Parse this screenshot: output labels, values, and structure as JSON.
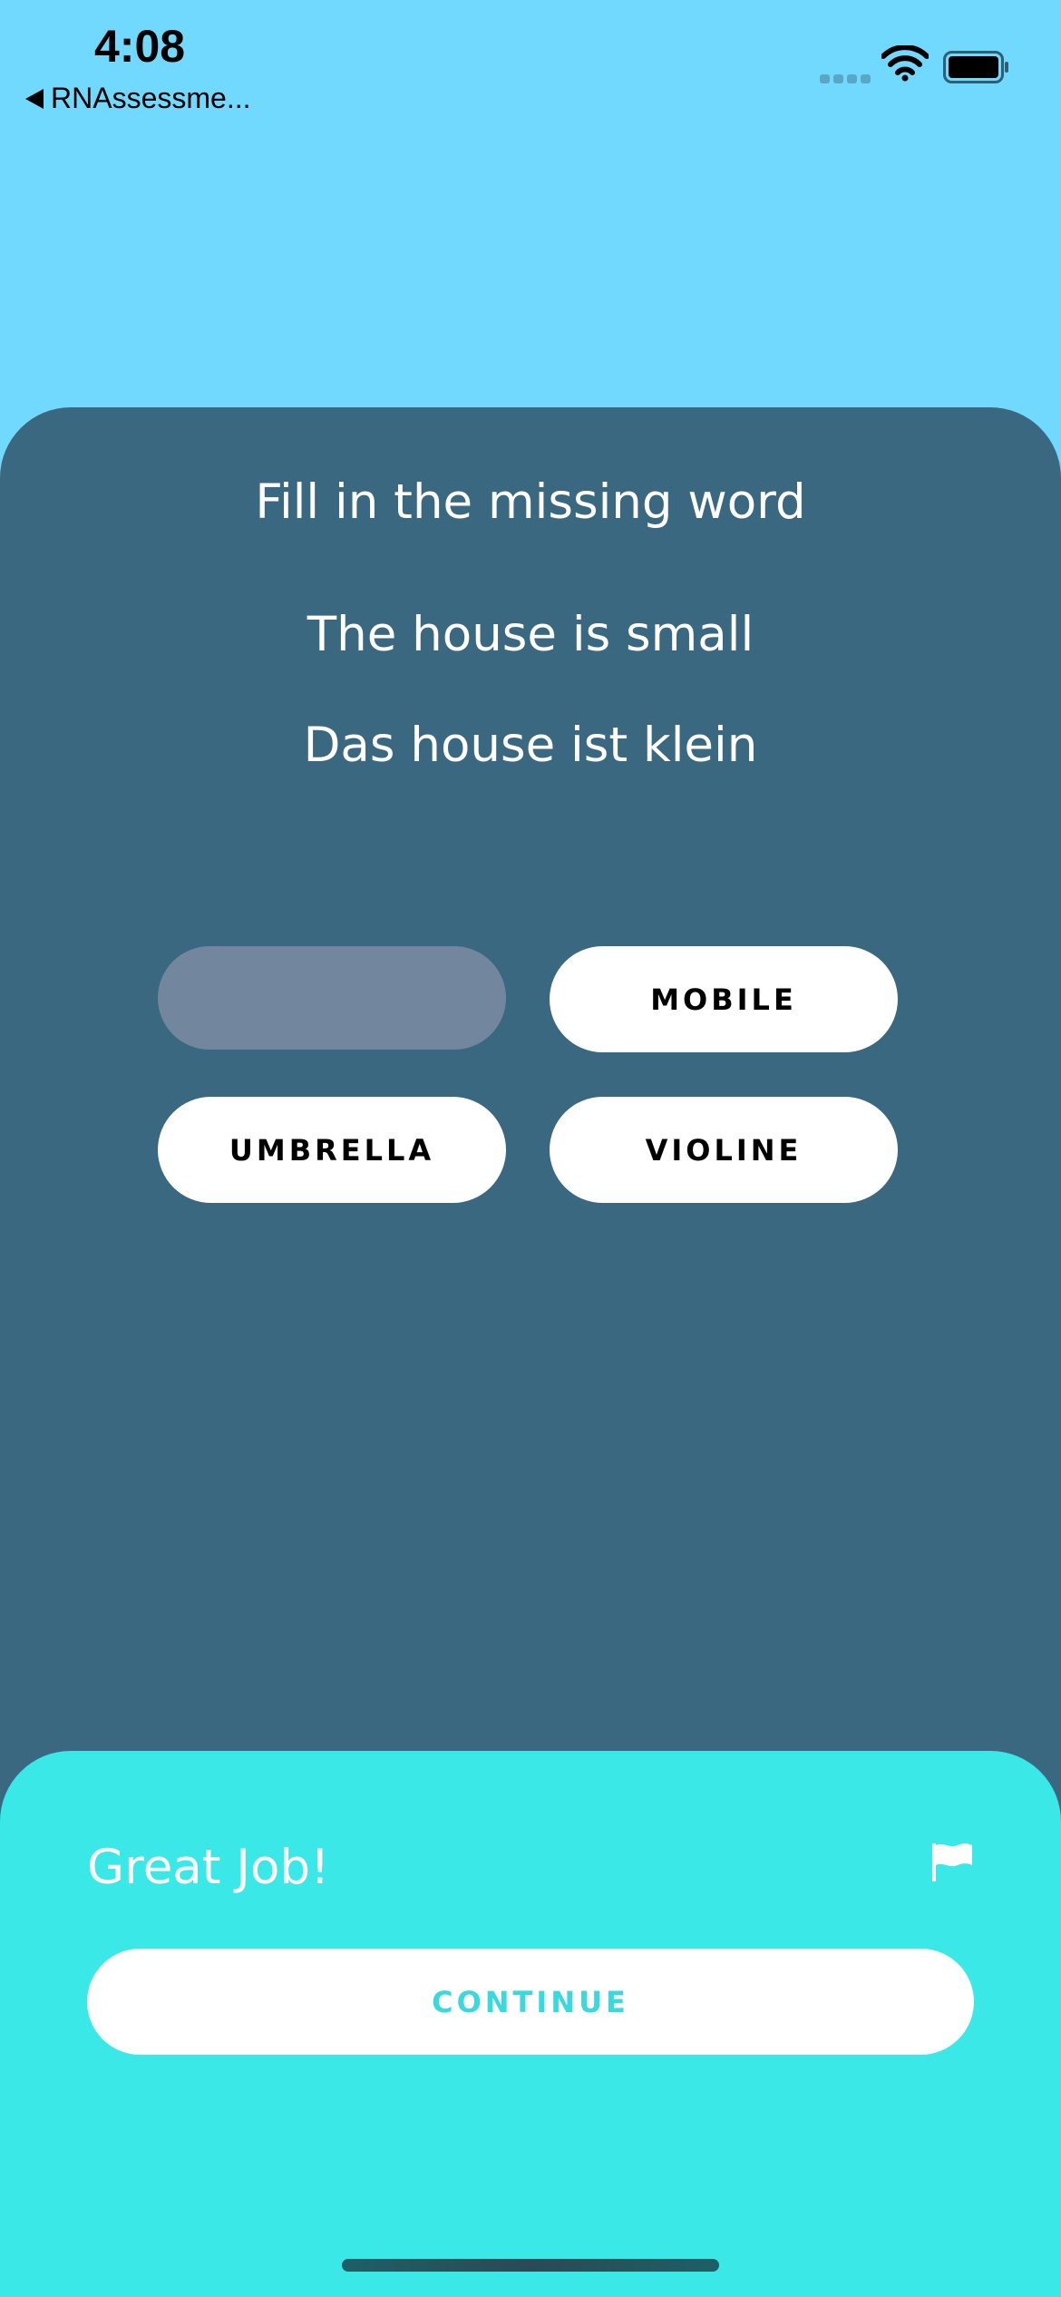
{
  "status_bar": {
    "time": "4:08",
    "back_label": "RNAssessme..."
  },
  "question": {
    "prompt": "Fill in the missing word",
    "sentence_english": "The house is small",
    "sentence_german": "Das house ist klein"
  },
  "options": {
    "empty_slot": "",
    "items": [
      "MOBILE",
      "UMBRELLA",
      "VIOLINE"
    ]
  },
  "feedback": {
    "title": "Great Job!",
    "continue_label": "CONTINUE"
  },
  "icons": {
    "back": "back-arrow-icon",
    "wifi": "wifi-icon",
    "battery": "battery-icon",
    "flag": "flag-icon"
  },
  "colors": {
    "background": "#72D9FE",
    "card": "#3A6880",
    "empty_slot": "#72879E",
    "feedback_panel": "#3AE8E8",
    "continue_text": "#3AD9DD"
  }
}
